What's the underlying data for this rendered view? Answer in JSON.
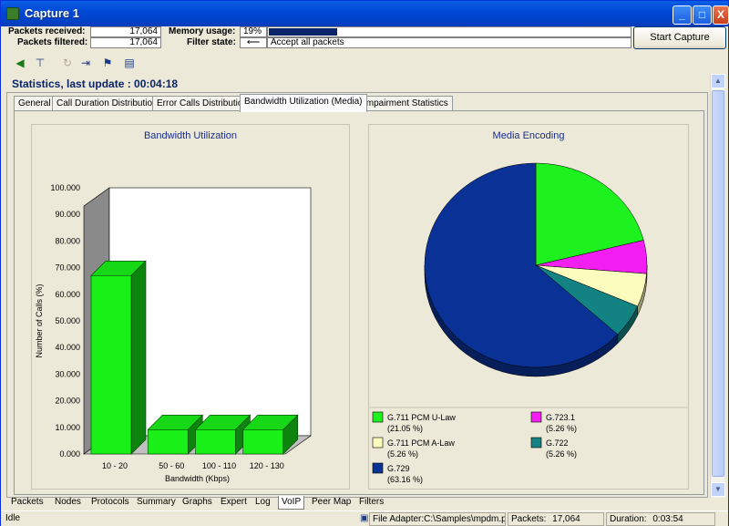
{
  "window": {
    "title": "Capture 1",
    "minimize": "_",
    "maximize": "□",
    "close": "X"
  },
  "info": {
    "packets_received_label": "Packets received:",
    "packets_received": "17,064",
    "packets_filtered_label": "Packets filtered:",
    "packets_filtered": "17,064",
    "memory_label": "Memory usage:",
    "memory_value": "19%",
    "memory_fraction": 0.19,
    "filter_label": "Filter state:",
    "filter_value": "Accept all packets",
    "start_button": "Start Capture"
  },
  "stats_header": "Statistics, last update : 00:04:18",
  "tabs": [
    {
      "label": "General"
    },
    {
      "label": "Call Duration Distribution"
    },
    {
      "label": "Error Calls Distribution"
    },
    {
      "label": "Bandwidth Utilization (Media)"
    },
    {
      "label": "Impairment Statistics"
    }
  ],
  "active_tab": 3,
  "chart_data": [
    {
      "type": "bar",
      "title": "Bandwidth Utilization",
      "xlabel": "Bandwidth (Kbps)",
      "ylabel": "Number of Calls (%)",
      "ylim": [
        0,
        100
      ],
      "ytick_labels": [
        "0.000",
        "10.000",
        "20.000",
        "30.000",
        "40.000",
        "50.000",
        "60.000",
        "70.000",
        "80.000",
        "90.000",
        "100.000"
      ],
      "categories": [
        "10 - 20",
        "50 - 60",
        "100 - 110",
        "120 - 130"
      ],
      "values": [
        68.4,
        10.5,
        10.5,
        10.5
      ],
      "color": "#18f018"
    },
    {
      "type": "pie",
      "title": "Media Encoding",
      "slices": [
        {
          "label": "G.711 PCM U-Law",
          "pct": "(21.05 %)",
          "value": 21.05,
          "color": "#1ef21e"
        },
        {
          "label": "G.723.1",
          "pct": "(5.26 %)",
          "value": 5.26,
          "color": "#f21ef2"
        },
        {
          "label": "G.711 PCM A-Law",
          "pct": "(5.26 %)",
          "value": 5.26,
          "color": "#fcfcbc"
        },
        {
          "label": "G.722",
          "pct": "(5.26 %)",
          "value": 5.26,
          "color": "#128282"
        },
        {
          "label": "G.729",
          "pct": "(63.16 %)",
          "value": 63.16,
          "color": "#0a3296"
        }
      ]
    }
  ],
  "bottom_tabs": [
    "Packets",
    "Nodes",
    "Protocols",
    "Summary",
    "Graphs",
    "Expert",
    "Log",
    "VoIP",
    "Peer Map",
    "Filters"
  ],
  "active_bottom_tab": 7,
  "status": {
    "state": "Idle",
    "adapter": "File Adapter:C:\\Samples\\mpdm.pkt",
    "packets_label": "Packets:",
    "packets": "17,064",
    "duration_label": "Duration:",
    "duration": "0:03:54"
  }
}
